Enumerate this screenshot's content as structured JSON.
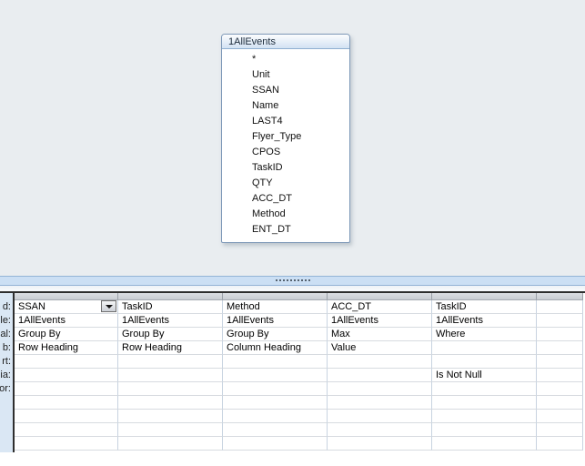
{
  "field_list": {
    "title": "1AllEvents",
    "fields": [
      "*",
      "Unit",
      "SSAN",
      "Name",
      "LAST4",
      "Flyer_Type",
      "CPOS",
      "TaskID",
      "QTY",
      "ACC_DT",
      "Method",
      "ENT_DT"
    ]
  },
  "splitter": {
    "grip_icon": "grip-dots-icon"
  },
  "grid": {
    "row_labels": [
      "d:",
      "le:",
      "al:",
      "b:",
      "rt:",
      "ia:",
      "or:"
    ],
    "columns": [
      {
        "field": "SSAN",
        "table": "1AllEvents",
        "total": "Group By",
        "crosstab": "Row Heading",
        "sort": "",
        "criteria": "",
        "or": ""
      },
      {
        "field": "TaskID",
        "table": "1AllEvents",
        "total": "Group By",
        "crosstab": "Row Heading",
        "sort": "",
        "criteria": "",
        "or": ""
      },
      {
        "field": "Method",
        "table": "1AllEvents",
        "total": "Group By",
        "crosstab": "Column Heading",
        "sort": "",
        "criteria": "",
        "or": ""
      },
      {
        "field": "ACC_DT",
        "table": "1AllEvents",
        "total": "Max",
        "crosstab": "Value",
        "sort": "",
        "criteria": "",
        "or": ""
      },
      {
        "field": "TaskID",
        "table": "1AllEvents",
        "total": "Where",
        "crosstab": "",
        "sort": "",
        "criteria": "Is Not Null",
        "or": ""
      },
      {
        "field": "",
        "table": "",
        "total": "",
        "crosstab": "",
        "sort": "",
        "criteria": "",
        "or": ""
      }
    ]
  },
  "icons": {
    "field_dropdown": "chevron-down-icon"
  },
  "colors": {
    "top_pane_bg": "#e9edf0",
    "splitter_bg": "#cbdff4",
    "row_label_bg": "#dae7f4",
    "field_list_header_top": "#fcfdfe",
    "field_list_header_bottom": "#d2e2f3",
    "field_list_border": "#7e99b8",
    "grid_hline": "#d7dbe0",
    "grid_vline": "#c8d3e0",
    "grid_outer_border": "#2e2e2e"
  }
}
